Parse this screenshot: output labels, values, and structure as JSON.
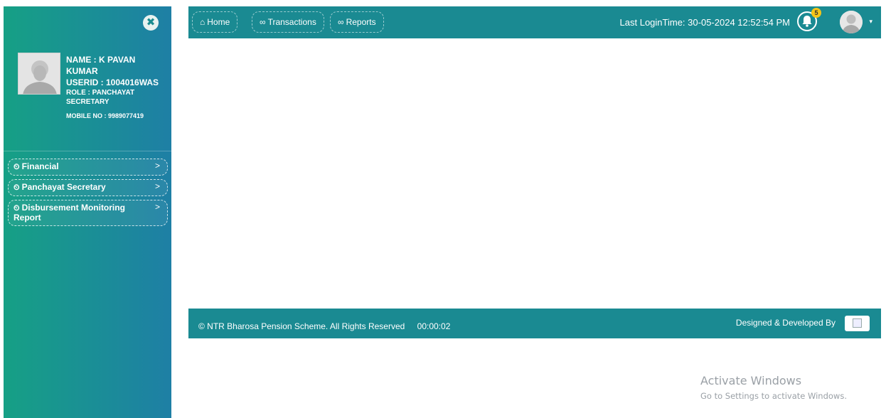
{
  "sidebar": {
    "close_icon": "times-circle-icon",
    "profile": {
      "name": "NAME : K PAVAN KUMAR",
      "userid": "USERID : 1004016WAS",
      "role": "ROLE : PANCHAYAT SECRETARY",
      "mobile": "MOBILE NO : 9989077419"
    },
    "menu": [
      {
        "label": "Financial",
        "icon": "dashboard-icon"
      },
      {
        "label": "Panchayat Secretary",
        "icon": "dashboard-icon"
      },
      {
        "label": "Disbursement Monitoring Report",
        "icon": "dashboard-icon"
      }
    ],
    "menu_chevron": ">"
  },
  "topbar": {
    "nav": [
      {
        "label": "Home",
        "icon": "home-icon"
      },
      {
        "label": "Transactions",
        "icon": "link-icon"
      },
      {
        "label": "Reports",
        "icon": "link-icon"
      }
    ],
    "last_login_label": "Last LoginTime:",
    "last_login_value": "30-05-2024 12:52:54 PM",
    "notification_count": "5"
  },
  "footer": {
    "copyright": "© NTR Bharosa Pension Scheme. All Rights Reserved",
    "timer": "00:00:02",
    "designed_by": "Designed & Developed By"
  },
  "watermark": {
    "title": "Activate Windows",
    "subtitle": "Go to Settings to activate Windows."
  },
  "colors": {
    "sidebar_start": "#16a085",
    "sidebar_end": "#1e7fa5",
    "bar": "#1a8a92",
    "badge": "#f5c518"
  }
}
